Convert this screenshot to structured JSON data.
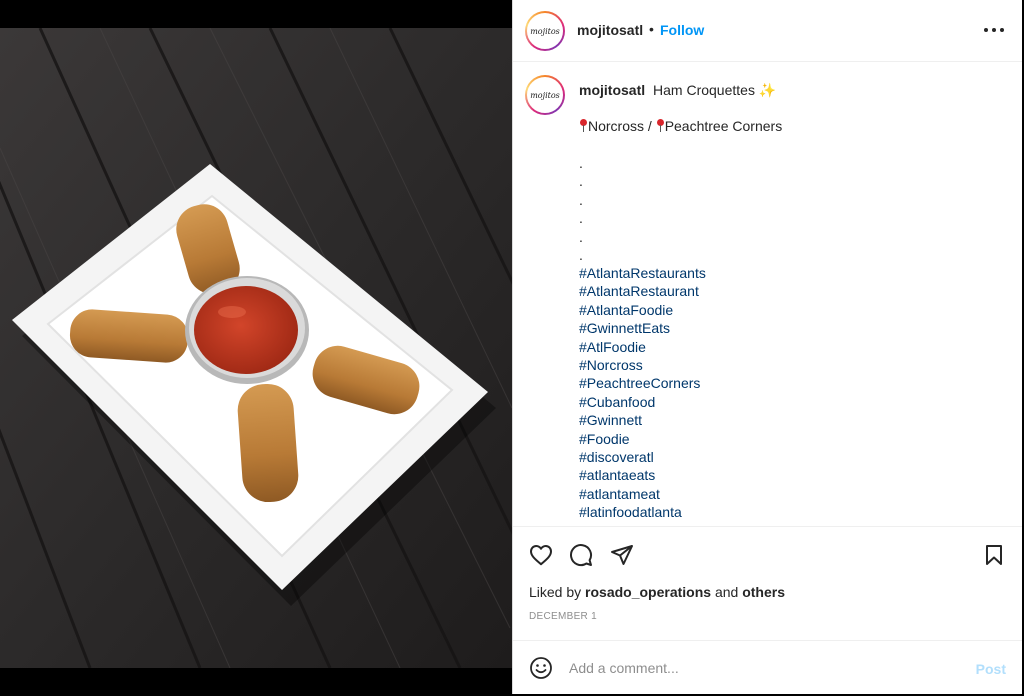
{
  "post": {
    "username": "mojitosatl",
    "avatar_text": "mojitos",
    "follow_label": "Follow",
    "separator": "•",
    "caption_title": "Ham Croquettes",
    "caption_emoji": "✨",
    "location_a": "Norcross",
    "location_sep": " / ",
    "location_b": "Peachtree Corners",
    "dots": [
      ".",
      ".",
      ".",
      ".",
      ".",
      "."
    ],
    "hashtags": [
      "#AtlantaRestaurants",
      "#AtlantaRestaurant",
      "#AtlantaFoodie",
      "#GwinnettEats",
      "#AtlFoodie",
      "#Norcross",
      "#PeachtreeCorners",
      "#Cubanfood",
      "#Gwinnett",
      "#Foodie",
      "#discoveratl",
      "#atlantaeats",
      "#atlantameat",
      "#latinfoodatlanta"
    ],
    "liked_by_prefix": "Liked by",
    "liked_by_user": "rosado_operations",
    "liked_by_and": "and",
    "liked_by_others": "others",
    "date": "DECEMBER 1"
  },
  "comment": {
    "placeholder": "Add a comment...",
    "post_label": "Post"
  },
  "icons": {
    "more": "more-options-icon",
    "like": "heart-icon",
    "comment": "comment-bubble-icon",
    "share": "paper-plane-icon",
    "save": "bookmark-icon",
    "emoji": "emoji-smile-icon"
  },
  "colors": {
    "link_blue": "#0095f6",
    "hashtag": "#00376b",
    "muted": "#8e8e8e",
    "post_disabled": "#b2dffc"
  }
}
